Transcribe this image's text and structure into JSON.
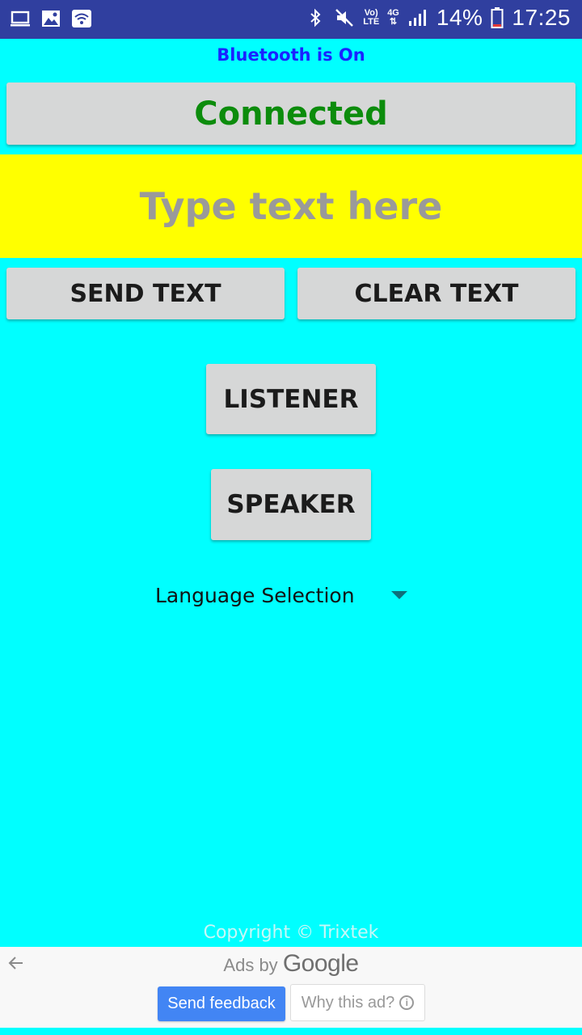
{
  "status_bar": {
    "network_top": "Vo)",
    "network_bottom": "LTE",
    "signal_label": "4G",
    "battery_percent": "14%",
    "time": "17:25"
  },
  "app": {
    "bluetooth_status": "Bluetooth is On",
    "connection_button": "Connected",
    "text_placeholder": "Type text here",
    "send_button": "SEND TEXT",
    "clear_button": "CLEAR TEXT",
    "listener_button": "LISTENER",
    "speaker_button": "SPEAKER",
    "language_selection": "Language Selection",
    "copyright": "Copyright © Trixtek"
  },
  "ad": {
    "ads_by": "Ads by",
    "brand": "Google",
    "feedback_button": "Send feedback",
    "why_button": "Why this ad?"
  },
  "colors": {
    "background": "#00FFFF",
    "status_bar": "#303F9F",
    "input_background": "#FFFF00",
    "connected_text": "#0C8C0C",
    "bluetooth_text": "#1A23FF",
    "feedback_button": "#4285F4"
  }
}
